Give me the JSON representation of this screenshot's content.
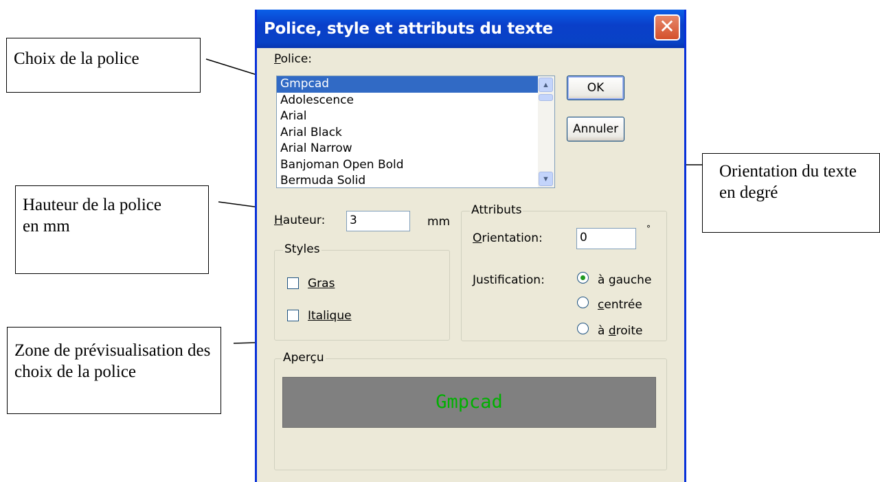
{
  "dialog": {
    "title": "Police, style et attributs du texte",
    "close_symbol": "✕",
    "font_label": "Police:",
    "font_label_mnemonic": "P",
    "font_list": [
      "Gmpcad",
      "Adolescence",
      "Arial",
      "Arial Black",
      "Arial Narrow",
      "Banjoman Open Bold",
      "Bermuda Solid"
    ],
    "font_selected": "Gmpcad",
    "ok_label": "OK",
    "cancel_label": "Annuler",
    "height_label": "Hauteur:",
    "height_label_mnemonic": "H",
    "height_value": "3",
    "height_unit": "mm",
    "styles_title": "Styles",
    "bold_label": "Gras",
    "bold_checked": false,
    "italic_label": "Italique",
    "italic_checked": false,
    "attributes_title": "Attributs",
    "orientation_label": "Orientation:",
    "orientation_value": "0",
    "orientation_unit": "°",
    "justification_label": "Justification:",
    "justify_left": "à gauche",
    "justify_center": "centrée",
    "justify_right": "à droite",
    "justification_selected": "à gauche",
    "preview_title": "Aperçu",
    "preview_text": "Gmpcad"
  },
  "callouts": {
    "font_choice": "Choix de la police",
    "height": "Hauteur de la police en mm",
    "orientation": "Orientation du texte en degré",
    "preview": "Zone de prévisualisation des choix de la police"
  },
  "colors": {
    "titlebar": "#0a5fe8",
    "dialog_bg": "#ece9d8",
    "selection": "#316ac5",
    "preview_bg": "#808080",
    "preview_text": "#00b000"
  },
  "icons": [
    "close-icon",
    "scroll-up-icon",
    "scroll-down-icon",
    "radio-dot-icon"
  ]
}
